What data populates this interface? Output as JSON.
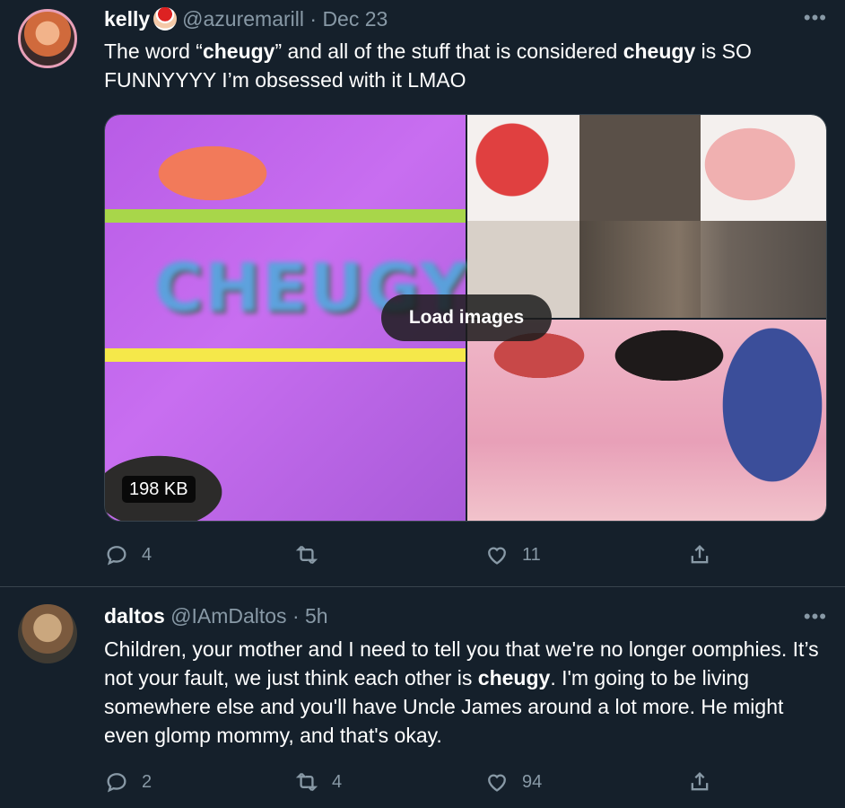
{
  "tweets": [
    {
      "author_name": "kelly",
      "author_emoji": "santa-icon",
      "handle": "@azuremarill",
      "separator": "·",
      "time": "Dec 23",
      "text_parts": [
        "The word “",
        "cheugy",
        "” and all of the stuff that is considered ",
        "cheugy",
        " is SO FUNNYYYY I’m obsessed with it LMAO"
      ],
      "media": {
        "load_label": "Load images",
        "size_label": "198 KB",
        "overlay_word": "CHEUGY"
      },
      "replies": "4",
      "retweets": "",
      "likes": "11"
    },
    {
      "author_name": "daltos",
      "handle": "@IAmDaltos",
      "separator": "·",
      "time": "5h",
      "text_parts": [
        "Children, your mother and I need to tell you that we're no longer oomphies. It’s not your fault, we just think each other is ",
        "cheugy",
        ".  I'm going to be living somewhere else and you'll have Uncle James around a lot more.  He might even glomp mommy, and that's okay."
      ],
      "replies": "2",
      "retweets": "4",
      "likes": "94"
    }
  ],
  "more_label": "•••",
  "colors": {
    "background": "#15202b",
    "secondary_text": "#8899a6",
    "divider": "#38444d"
  }
}
